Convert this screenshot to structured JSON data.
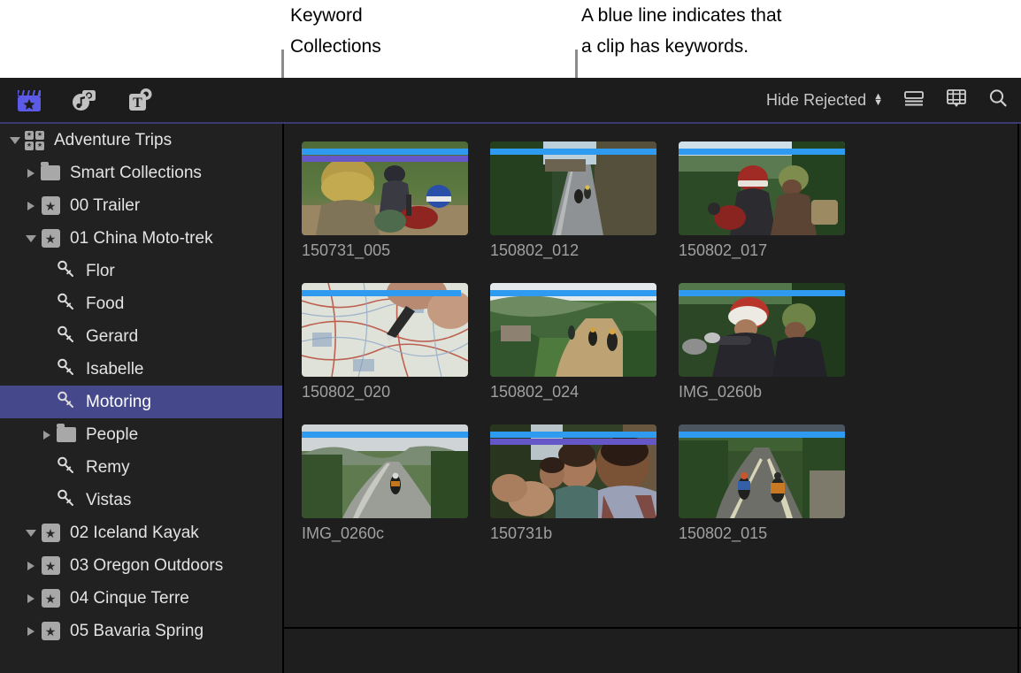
{
  "callouts": [
    {
      "id": "keyword",
      "text": "Keyword\nCollections"
    },
    {
      "id": "blueline",
      "text": "A blue line indicates that\na clip has keywords."
    }
  ],
  "toolbar": {
    "left_icons": [
      {
        "name": "libraries-icon",
        "glyph": "clapperboard-star",
        "selected": true
      },
      {
        "name": "photos-audio-icon",
        "glyph": "photos-audio",
        "selected": false
      },
      {
        "name": "titles-generators-icon",
        "glyph": "titles-T",
        "selected": false
      }
    ],
    "hide_rejected_label": "Hide Rejected",
    "right_icons": [
      {
        "name": "list-view-icon"
      },
      {
        "name": "filmstrip-view-icon"
      },
      {
        "name": "search-icon"
      }
    ],
    "accent_color": "#3b3b72"
  },
  "sidebar": {
    "selection_color": "#45498c",
    "items": [
      {
        "label": "Adventure Trips",
        "icon": "library-icon",
        "indent": 0,
        "disclosure": "open",
        "selected": false
      },
      {
        "label": "Smart Collections",
        "icon": "folder-icon",
        "indent": 1,
        "disclosure": "closed",
        "selected": false
      },
      {
        "label": "00 Trailer",
        "icon": "event-icon",
        "indent": 1,
        "disclosure": "closed",
        "selected": false
      },
      {
        "label": "01 China Moto-trek",
        "icon": "event-icon",
        "indent": 1,
        "disclosure": "open",
        "selected": false
      },
      {
        "label": "Flor",
        "icon": "keyword-icon",
        "indent": 2,
        "disclosure": "none",
        "selected": false
      },
      {
        "label": "Food",
        "icon": "keyword-icon",
        "indent": 2,
        "disclosure": "none",
        "selected": false
      },
      {
        "label": "Gerard",
        "icon": "keyword-icon",
        "indent": 2,
        "disclosure": "none",
        "selected": false
      },
      {
        "label": "Isabelle",
        "icon": "keyword-icon",
        "indent": 2,
        "disclosure": "none",
        "selected": false
      },
      {
        "label": "Motoring",
        "icon": "keyword-icon",
        "indent": 2,
        "disclosure": "none",
        "selected": true
      },
      {
        "label": "People",
        "icon": "folder-icon",
        "indent": 2,
        "disclosure": "closed",
        "selected": false
      },
      {
        "label": "Remy",
        "icon": "keyword-icon",
        "indent": 2,
        "disclosure": "none",
        "selected": false
      },
      {
        "label": "Vistas",
        "icon": "keyword-icon",
        "indent": 2,
        "disclosure": "none",
        "selected": false
      },
      {
        "label": "02 Iceland Kayak",
        "icon": "event-icon",
        "indent": 1,
        "disclosure": "open",
        "selected": false
      },
      {
        "label": "03 Oregon Outdoors",
        "icon": "event-icon",
        "indent": 1,
        "disclosure": "closed",
        "selected": false
      },
      {
        "label": "04 Cinque Terre",
        "icon": "event-icon",
        "indent": 1,
        "disclosure": "closed",
        "selected": false
      },
      {
        "label": "05 Bavaria Spring",
        "icon": "event-icon",
        "indent": 1,
        "disclosure": "closed",
        "selected": false
      }
    ]
  },
  "browser": {
    "keyword_line_color": "#2e9bf0",
    "second_line_color": "#6657c8",
    "clips": [
      {
        "name": "150731_005",
        "keyword_line_pct": 100,
        "second_line_pct": 100,
        "scene": "two-riders-gold-helmet-dirt-road"
      },
      {
        "name": "150802_012",
        "keyword_line_pct": 100,
        "second_line_pct": 0,
        "scene": "bikes-on-forest-road-cliff"
      },
      {
        "name": "150802_017",
        "keyword_line_pct": 100,
        "second_line_pct": 0,
        "scene": "two-riders-red-green-helmets-jungle"
      },
      {
        "name": "150802_020",
        "keyword_line_pct": 96,
        "second_line_pct": 0,
        "scene": "hand-pointing-at-paper-map"
      },
      {
        "name": "150802_024",
        "keyword_line_pct": 100,
        "second_line_pct": 0,
        "scene": "riders-on-mountain-dirt-trail"
      },
      {
        "name": "IMG_0260b",
        "keyword_line_pct": 100,
        "second_line_pct": 0,
        "scene": "two-riders-white-green-helmets-close"
      },
      {
        "name": "IMG_0260c",
        "keyword_line_pct": 100,
        "second_line_pct": 0,
        "scene": "lone-rider-wet-road-hills"
      },
      {
        "name": "150731b",
        "keyword_line_pct": 100,
        "second_line_pct": 100,
        "scene": "three-friends-in-car-portrait"
      },
      {
        "name": "150802_015",
        "keyword_line_pct": 100,
        "second_line_pct": 0,
        "scene": "two-loaded-bikes-winding-road"
      }
    ]
  }
}
